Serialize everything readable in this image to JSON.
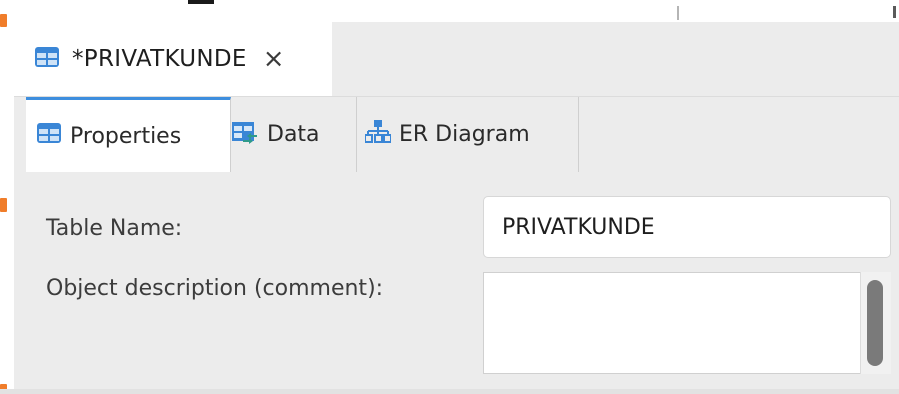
{
  "editor": {
    "tab_title": "*PRIVATKUNDE",
    "close_glyph": "×",
    "tab_icon": "table-icon"
  },
  "subtabs": [
    {
      "label": "Properties",
      "icon": "table-icon",
      "active": true
    },
    {
      "label": "Data",
      "icon": "data-grid-icon",
      "active": false
    },
    {
      "label": "ER Diagram",
      "icon": "er-diagram-icon",
      "active": false
    }
  ],
  "properties": {
    "table_name_label": "Table Name:",
    "table_name_value": "PRIVATKUNDE",
    "description_label": "Object description (comment):",
    "description_value": ""
  },
  "colors": {
    "accent": "#3d8ede",
    "marker": "#f07d2a",
    "panel_bg": "#ececec"
  }
}
